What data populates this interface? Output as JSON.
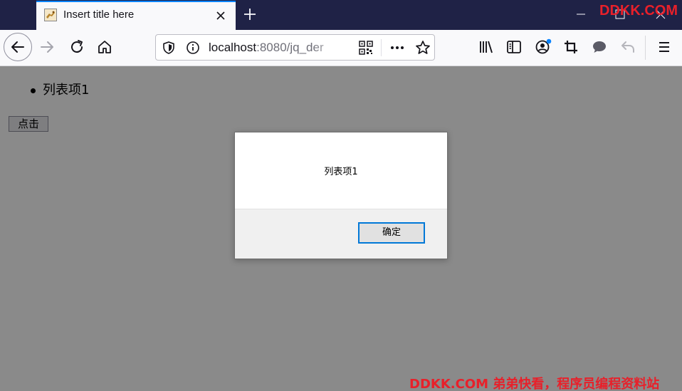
{
  "browser": {
    "tab": {
      "title": "Insert title here",
      "close_icon": "close-icon",
      "favicon": "tomcat-favicon-icon"
    },
    "new_tab_icon": "plus-icon",
    "window_controls": [
      "minimize-icon",
      "maximize-icon",
      "close-icon"
    ],
    "nav": {
      "back_icon": "arrow-left-icon",
      "forward_icon": "arrow-right-icon",
      "reload_icon": "reload-icon",
      "home_icon": "home-icon"
    },
    "urlbar": {
      "host": "localhost",
      "path": ":8080/jq_der",
      "icons": [
        "shield-icon",
        "info-icon",
        "qr-code-icon",
        "more-icon",
        "star-icon"
      ]
    },
    "toolbar_icons": [
      "library-icon",
      "sidebar-icon",
      "account-icon",
      "crop-icon",
      "chat-icon",
      "undo-icon",
      "menu-icon"
    ],
    "accent_color": "#0a84ff"
  },
  "page": {
    "list_items": [
      "列表项1"
    ],
    "button_label": "点击"
  },
  "dialog": {
    "message": "列表项1",
    "ok_label": "确定",
    "ok_border_color": "#0078d7"
  },
  "watermark": {
    "top": "DDKK.COM",
    "bottom": "DDKK.COM 弟弟快看，程序员编程资料站",
    "color": "#e8202a"
  }
}
